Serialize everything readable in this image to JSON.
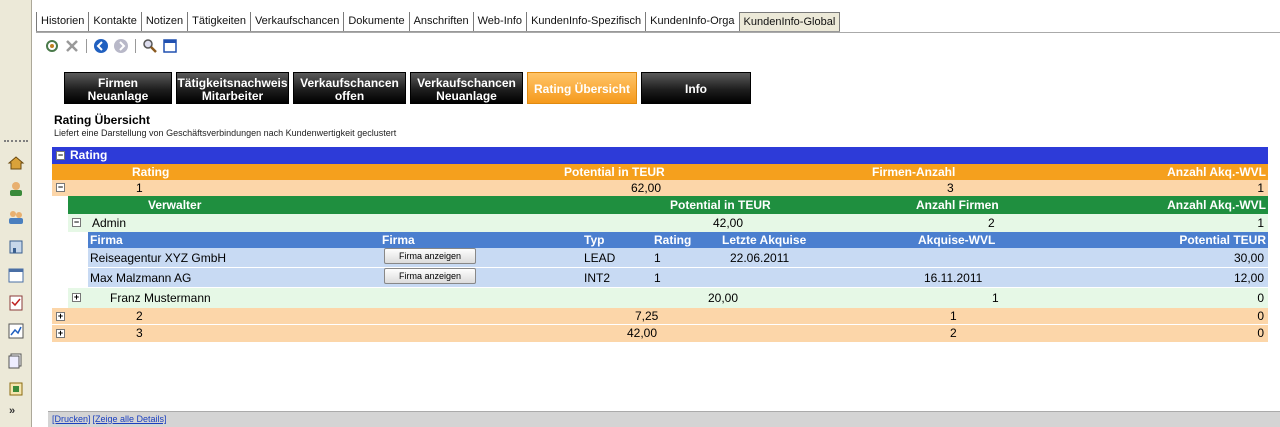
{
  "tabs": [
    "Historien",
    "Kontakte",
    "Notizen",
    "Tätigkeiten",
    "Verkaufschancen",
    "Dokumente",
    "Anschriften",
    "Web-Info",
    "KundenInfo-Spezifisch",
    "KundenInfo-Orga",
    "KundenInfo-Global"
  ],
  "nav": {
    "firmen_l1": "Firmen",
    "firmen_l2": "Neuanlage",
    "tatig_l1": "Tätigkeitsnachweis",
    "tatig_l2": "Mitarbeiter",
    "vkoffen_l1": "Verkaufschancen",
    "vkoffen_l2": "offen",
    "vkneu_l1": "Verkaufschancen",
    "vkneu_l2": "Neuanlage",
    "rating": "Rating Übersicht",
    "info": "Info"
  },
  "page": {
    "title": "Rating Übersicht",
    "desc": "Liefert eine Darstellung von Geschäftsverbindungen nach Kundenwertigkeit geclustert"
  },
  "grid": {
    "group_title": "Rating",
    "h_rating": "Rating",
    "h_potential": "Potential in TEUR",
    "h_firmen": "Firmen-Anzahl",
    "h_akq": "Anzahl Akq.-WVL",
    "r1": {
      "rating": "1",
      "potential": "62,00",
      "firmen": "3",
      "akq": "1"
    },
    "v_hdr": {
      "verwalter": "Verwalter",
      "potential": "Potential in TEUR",
      "anzahl": "Anzahl Firmen",
      "akq": "Anzahl Akq.-WVL"
    },
    "v1": {
      "name": "Admin",
      "potential": "42,00",
      "anzahl": "2",
      "akq": "1"
    },
    "f_hdr": {
      "firma": "Firma",
      "firma2": "Firma",
      "typ": "Typ",
      "rating": "Rating",
      "letzte": "Letzte Akquise",
      "wvl": "Akquise-WVL",
      "pot": "Potential TEUR"
    },
    "f1": {
      "firma": "Reiseagentur XYZ GmbH",
      "btn": "Firma anzeigen",
      "typ": "LEAD",
      "rating": "1",
      "letzte": "22.06.2011",
      "wvl": "",
      "pot": "30,00"
    },
    "f2": {
      "firma": "Max Malzmann AG",
      "btn": "Firma anzeigen",
      "typ": "INT2",
      "rating": "1",
      "letzte": "",
      "wvl": "16.11.2011",
      "pot": "12,00"
    },
    "v2": {
      "name": "Franz Mustermann",
      "potential": "20,00",
      "anzahl": "1",
      "akq": "0"
    },
    "r2": {
      "rating": "2",
      "potential": "7,25",
      "firmen": "1",
      "akq": "0"
    },
    "r3": {
      "rating": "3",
      "potential": "42,00",
      "firmen": "2",
      "akq": "0"
    }
  },
  "footer": {
    "print": "[Drucken]",
    "details": "[Zeige alle Details]"
  }
}
